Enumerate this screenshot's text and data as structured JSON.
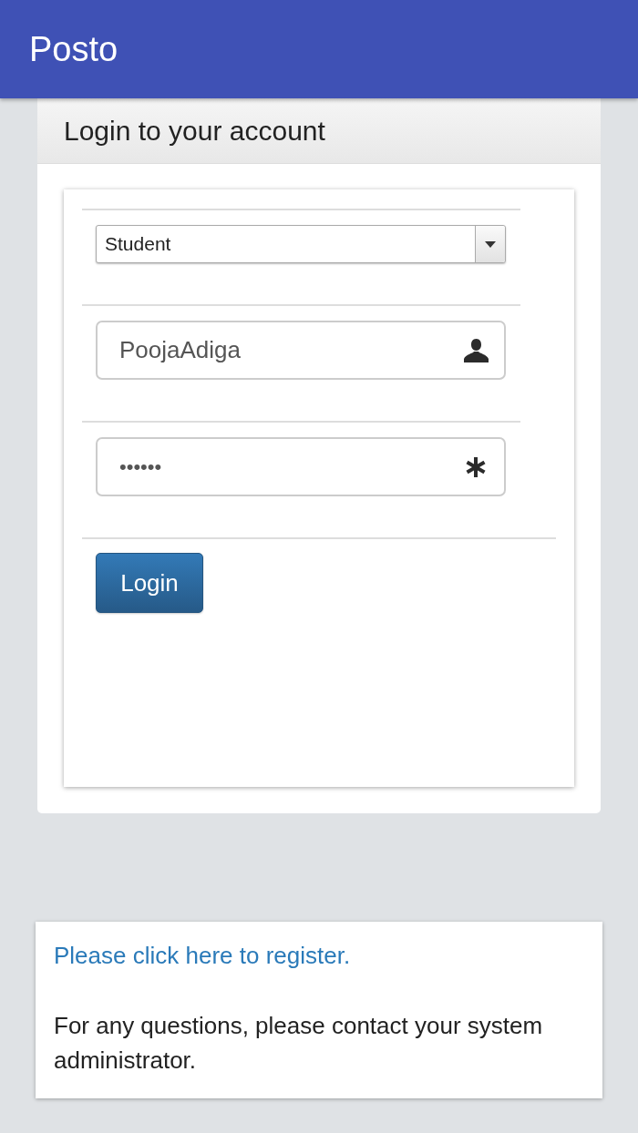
{
  "app_bar": {
    "title": "Posto"
  },
  "login_panel": {
    "heading": "Login to your account",
    "role_select": {
      "value": "Student"
    },
    "username_field": {
      "value": "PoojaAdiga"
    },
    "password_field": {
      "value": "••••••"
    },
    "login_button": {
      "label": "Login"
    }
  },
  "info_panel": {
    "register_link": "Please click here to register.",
    "note": "For any questions, please contact your system administrator."
  }
}
